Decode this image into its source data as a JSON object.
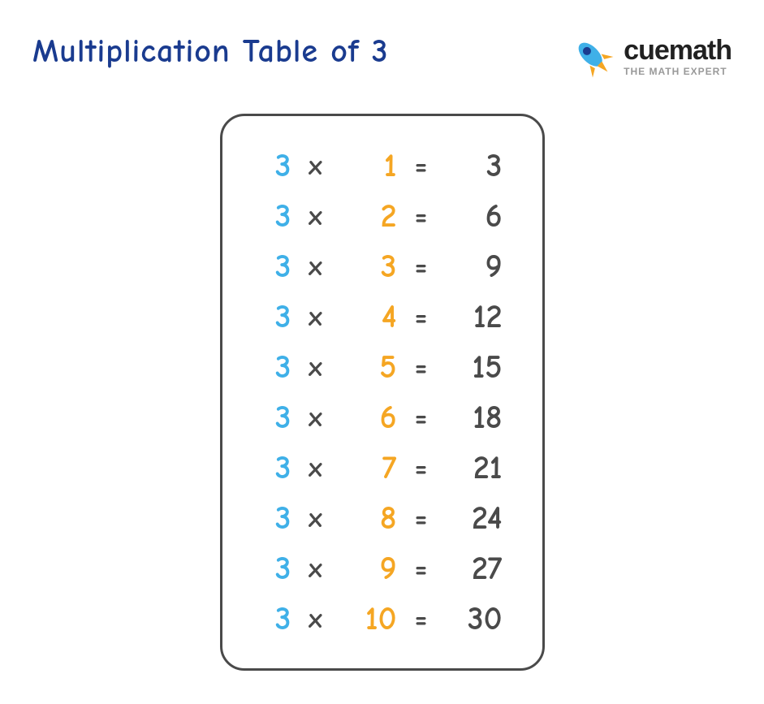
{
  "title": "Multiplication Table of 3",
  "brand": {
    "name_part1": "cue",
    "name_part2": "math",
    "tagline": "THE MATH EXPERT"
  },
  "table": {
    "rows": [
      {
        "base": "3",
        "op": "x",
        "mult": "1",
        "eq": "=",
        "result": "3"
      },
      {
        "base": "3",
        "op": "x",
        "mult": "2",
        "eq": "=",
        "result": "6"
      },
      {
        "base": "3",
        "op": "x",
        "mult": "3",
        "eq": "=",
        "result": "9"
      },
      {
        "base": "3",
        "op": "x",
        "mult": "4",
        "eq": "=",
        "result": "12"
      },
      {
        "base": "3",
        "op": "x",
        "mult": "5",
        "eq": "=",
        "result": "15"
      },
      {
        "base": "3",
        "op": "x",
        "mult": "6",
        "eq": "=",
        "result": "18"
      },
      {
        "base": "3",
        "op": "x",
        "mult": "7",
        "eq": "=",
        "result": "21"
      },
      {
        "base": "3",
        "op": "x",
        "mult": "8",
        "eq": "=",
        "result": "24"
      },
      {
        "base": "3",
        "op": "x",
        "mult": "9",
        "eq": "=",
        "result": "27"
      },
      {
        "base": "3",
        "op": "x",
        "mult": "10",
        "eq": "=",
        "result": "30"
      }
    ]
  }
}
